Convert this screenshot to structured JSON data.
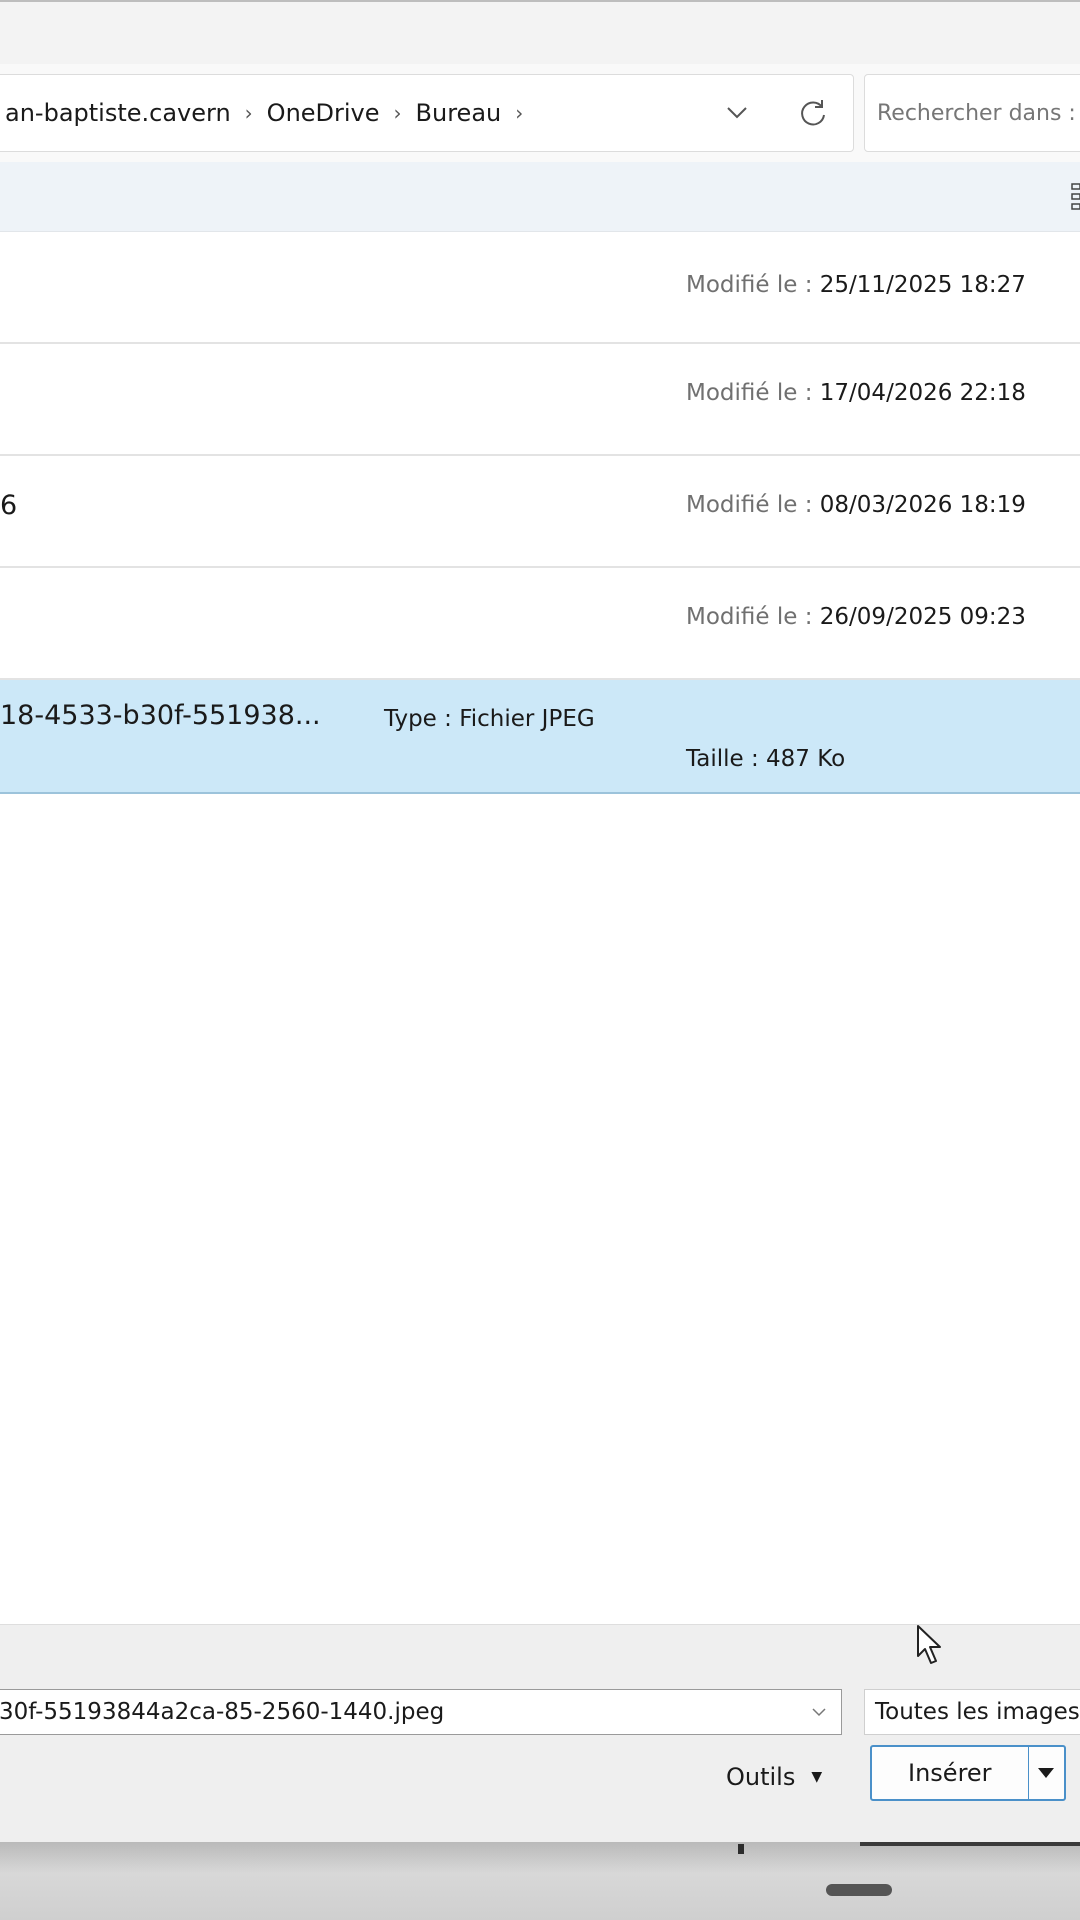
{
  "breadcrumb": {
    "items": [
      "an-baptiste.cavern",
      "OneDrive",
      "Bureau"
    ]
  },
  "search": {
    "placeholder": "Rechercher dans :"
  },
  "files": [
    {
      "name": "",
      "meta_label": "Modifié le :",
      "meta_value": "25/11/2025 18:27"
    },
    {
      "name": "",
      "meta_label": "Modifié le :",
      "meta_value": "17/04/2026 22:18"
    },
    {
      "name": "6",
      "meta_label": "Modifié le :",
      "meta_value": "08/03/2026 18:19"
    },
    {
      "name": "",
      "meta_label": "Modifié le :",
      "meta_value": "26/09/2025 09:23"
    }
  ],
  "selected_file": {
    "name": "18-4533-b30f-551938...",
    "type_label": "Type :",
    "type_value": "Fichier JPEG",
    "size_label": "Taille :",
    "size_value": "487 Ko"
  },
  "bottom": {
    "filename_value": "30f-55193844a2ca-85-2560-1440.jpeg",
    "filter_label": "Toutes les images",
    "tools_label": "Outils",
    "insert_label": "Insérer"
  },
  "colors": {
    "selection": "#cce8f8",
    "accent": "#4a90c9"
  }
}
